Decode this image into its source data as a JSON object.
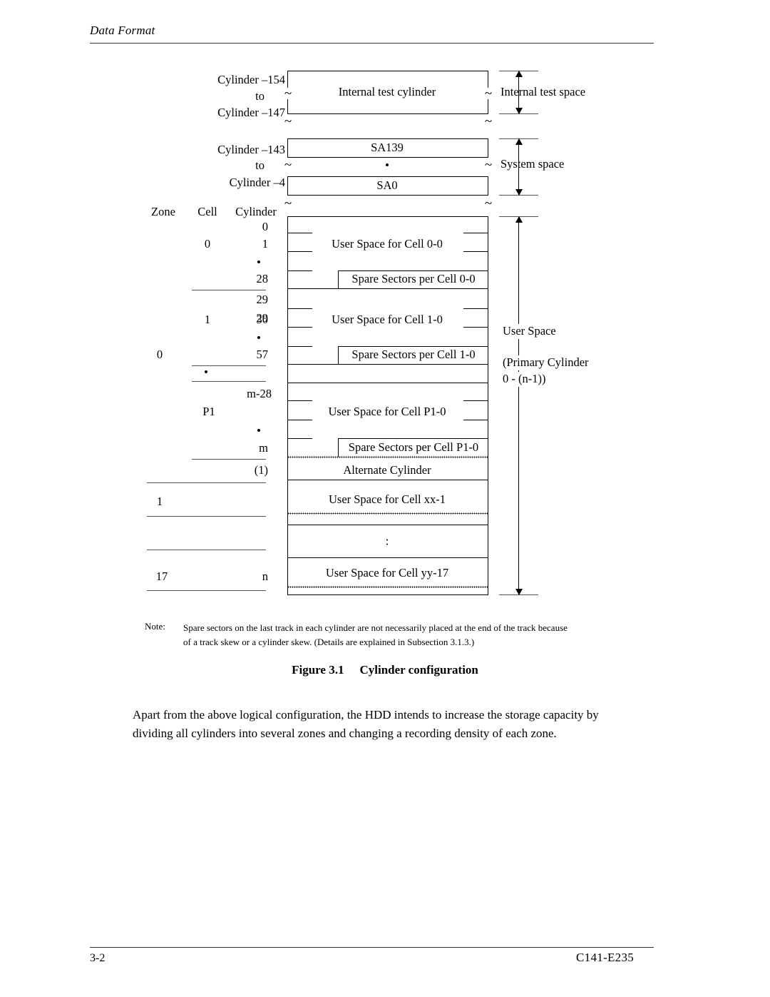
{
  "running_head": "Data Format",
  "footer": {
    "page_number": "3-2",
    "doc_id": "C141-E235"
  },
  "figure": {
    "caption_number": "Figure 3.1",
    "caption_title": "Cylinder configuration",
    "column_headers": {
      "zone": "Zone",
      "cell": "Cell",
      "cylinder": "Cylinder"
    },
    "left_labels": {
      "test_from": "Cylinder –154",
      "test_to_word": "to",
      "test_to": "Cylinder –147",
      "system_from": "Cylinder –143",
      "system_to_word": "to",
      "system_to": "Cylinder –4"
    },
    "cylinder_values": {
      "c0": "0",
      "c1": "1",
      "c28": "28",
      "c29": "29",
      "c30": "30",
      "c57": "57",
      "cm28": "m-28",
      "cm": "m",
      "calt": "(1)",
      "cn": "n"
    },
    "cell_values": {
      "cell0": "0",
      "cell1": "1",
      "cellP1": "P1"
    },
    "zone_values": {
      "zone0": "0",
      "zone1": "1",
      "zone17": "17"
    },
    "boxes": {
      "internal_test_cylinder": "Internal test cylinder",
      "sa139": "SA139",
      "sa0": "SA0",
      "user_space_cell_0_0": "User Space for Cell 0-0",
      "spare_sectors_cell_0_0": "Spare Sectors per Cell 0-0",
      "user_space_cell_1_0": "User Space for Cell 1-0",
      "spare_sectors_cell_1_0": "Spare Sectors per Cell 1-0",
      "user_space_cell_P1_0": "User Space for Cell P1-0",
      "spare_sectors_cell_P1_0": "Spare Sectors per Cell P1-0",
      "alternate_cylinder": "Alternate Cylinder",
      "user_space_cell_xx_1": "User Space for Cell xx-1",
      "user_space_cell_yy_17": "User Space for Cell yy-17"
    },
    "right_labels": {
      "internal_test_space": "Internal test space",
      "system_space": "System space",
      "user_space": "User Space",
      "primary_cylinder_1": "(Primary Cylinder",
      "primary_cylinder_2": "0 - (n-1))"
    },
    "note_keyword": "Note:",
    "note_text": "Spare sectors on the last track in each cylinder are not necessarily placed at the end of the track because of a track skew or a cylinder skew. (Details are explained in Subsection 3.1.3.)"
  },
  "body_paragraph": "Apart from the above logical configuration, the HDD intends to increase the storage capacity by dividing all cylinders into several zones and changing a recording density of each zone."
}
